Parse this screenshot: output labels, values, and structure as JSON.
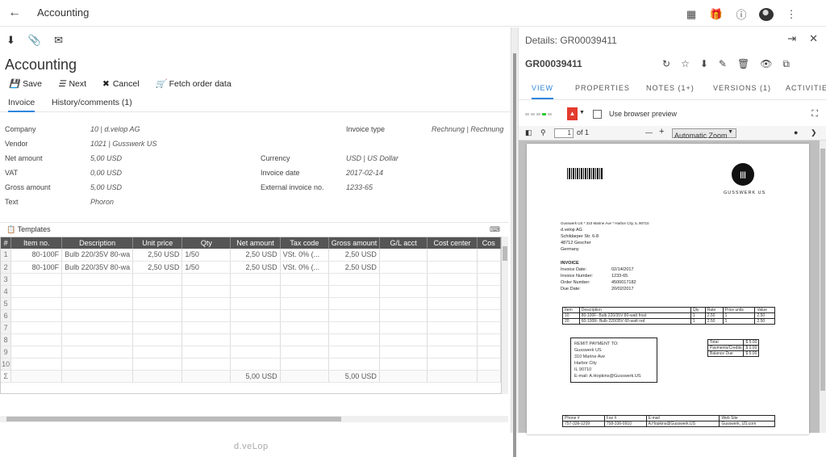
{
  "app": {
    "title": "Accounting"
  },
  "left": {
    "heading": "Accounting",
    "actions": {
      "save": "Save",
      "next": "Next",
      "cancel": "Cancel",
      "fetch": "Fetch order data"
    },
    "tabs": {
      "invoice": "Invoice",
      "history": "History/comments (1)"
    },
    "fields": {
      "company": {
        "label": "Company",
        "value": "10 | d.velop AG"
      },
      "vendor": {
        "label": "Vendor",
        "value": "1021 | Gusswerk US"
      },
      "net_amount": {
        "label": "Net amount",
        "value": "5,00 USD"
      },
      "vat": {
        "label": "VAT",
        "value": "0,00 USD"
      },
      "gross_amount": {
        "label": "Gross amount",
        "value": "5,00 USD"
      },
      "text": {
        "label": "Text",
        "value": "Phoron"
      },
      "currency": {
        "label": "Currency",
        "value": "USD | US Dollar"
      },
      "invoice_date": {
        "label": "Invoice date",
        "value": "2017-02-14"
      },
      "external_no": {
        "label": "External invoice no.",
        "value": "1233-65"
      },
      "invoice_type": {
        "label": "Invoice type",
        "value": "Rechnung | Rechnung"
      }
    },
    "templates": "Templates",
    "grid": {
      "corner": "#",
      "columns": [
        "Item no.",
        "Description",
        "Unit price",
        "Qty",
        "Net amount",
        "Tax code",
        "Gross amount",
        "G/L acct",
        "Cost center",
        "Cos"
      ],
      "rows": [
        [
          "1",
          "80-100F",
          "Bulb 220/35V 80-wa",
          "2,50 USD",
          "1/50",
          "2,50 USD",
          "VSt. 0% (...",
          "2,50 USD",
          "",
          "",
          ""
        ],
        [
          "2",
          "80-100F",
          "Bulb 220/35V 80-wa",
          "2,50 USD",
          "1/50",
          "2,50 USD",
          "VSt. 0% (...",
          "2,50 USD",
          "",
          "",
          ""
        ],
        [
          "3",
          "",
          "",
          "",
          "",
          "",
          "",
          "",
          "",
          "",
          ""
        ],
        [
          "4",
          "",
          "",
          "",
          "",
          "",
          "",
          "",
          "",
          "",
          ""
        ],
        [
          "5",
          "",
          "",
          "",
          "",
          "",
          "",
          "",
          "",
          "",
          ""
        ],
        [
          "6",
          "",
          "",
          "",
          "",
          "",
          "",
          "",
          "",
          "",
          ""
        ],
        [
          "7",
          "",
          "",
          "",
          "",
          "",
          "",
          "",
          "",
          "",
          ""
        ],
        [
          "8",
          "",
          "",
          "",
          "",
          "",
          "",
          "",
          "",
          "",
          ""
        ],
        [
          "9",
          "",
          "",
          "",
          "",
          "",
          "",
          "",
          "",
          "",
          ""
        ],
        [
          "10",
          "",
          "",
          "",
          "",
          "",
          "",
          "",
          "",
          "",
          ""
        ]
      ],
      "sum_symbol": "Σ",
      "sum_net": "5,00 USD",
      "sum_gross": "5,00 USD"
    },
    "brand": "d.veLop"
  },
  "right": {
    "title": "Details: GR00039411",
    "doc_id": "GR00039411",
    "tabs": [
      "VIEW",
      "PROPERTIES",
      "NOTES (1+)",
      "VERSIONS (1)",
      "ACTIVITIES"
    ],
    "use_browser_preview": "Use browser preview",
    "pdf": {
      "page": "1",
      "of": "of 1",
      "zoom": "Automatic Zoom"
    }
  },
  "invoice_doc": {
    "brand": "GUSSWERK US",
    "sender": "Gusswerk US * 310 Marine Ave * Harbor City, IL 90710",
    "recipient": [
      "d.velop AG",
      "Schildarper Str. 6-8",
      "48712 Gescher",
      "Germany"
    ],
    "title": "INVOICE",
    "meta": [
      [
        "Invoice Date:",
        "02/14/2017"
      ],
      [
        "Invoice Number:",
        "1233-65"
      ],
      [
        "Order Number:",
        "4500017182"
      ],
      [
        "Due Date:",
        "20/02/2017"
      ]
    ],
    "items_header": [
      "Item",
      "Description",
      "Qty",
      "Rate",
      "Price units",
      "Value"
    ],
    "items": [
      [
        "10",
        "80-100F- Bulb 220/35V 80-watt frost",
        "1",
        "2.50",
        "1",
        "2.50"
      ],
      [
        "20",
        "60-100R- Bulb 220/35V 60-watt red",
        "1",
        "2.50",
        "1",
        "2.50"
      ]
    ],
    "totals": [
      [
        "Total",
        "$ 5.00"
      ],
      [
        "Payments/Credits",
        "$ 0.00"
      ],
      [
        "Balance Due",
        "$ 5.00"
      ]
    ],
    "remit": [
      "REMIT PAYMENT TO:",
      "Gusswerk US",
      "310 Marine Ave",
      "Harbor City",
      "IL 90710",
      "E-mail: A.Hopkins@Gusswerk.US"
    ],
    "footer_header": [
      "Phone #",
      "Fax #",
      "E-mail",
      "Web Site"
    ],
    "footer": [
      "757-336-1209",
      "758-336-0910",
      "A.Hopkins@Gusswerk.US",
      "Gusswerk_US.com"
    ]
  }
}
